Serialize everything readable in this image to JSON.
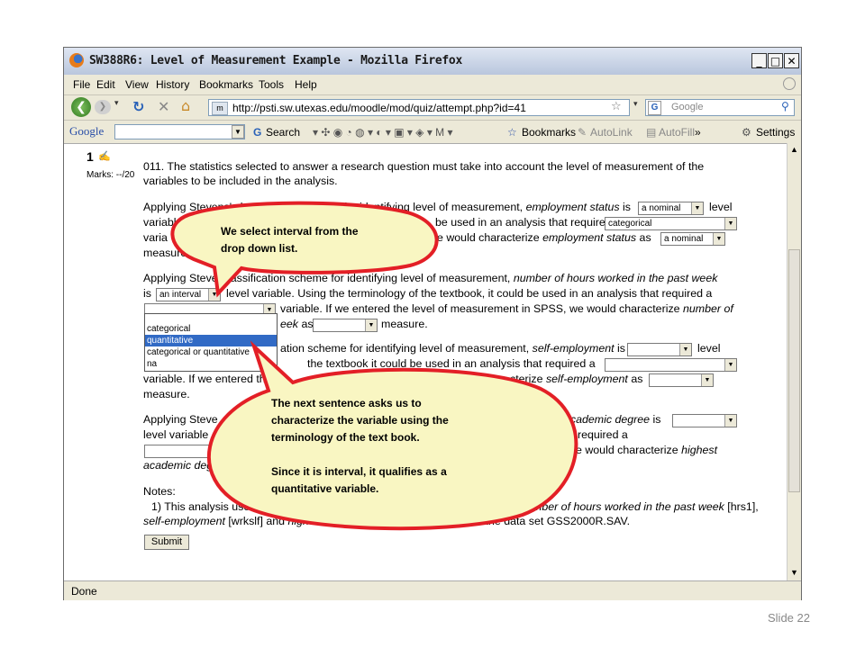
{
  "window": {
    "title": "SW388R6: Level of Measurement Example - Mozilla Firefox",
    "buttons": [
      "_",
      "□",
      "✕"
    ]
  },
  "menu": {
    "items": [
      "File",
      "Edit",
      "View",
      "History",
      "Bookmarks",
      "Tools",
      "Help"
    ]
  },
  "nav": {
    "url": "http://psti.sw.utexas.edu/moodle/mod/quiz/attempt.php?id=41",
    "search_placeholder": "Google"
  },
  "google_toolbar": {
    "brand": "Google",
    "search_label": "Search",
    "bookmarks_label": "Bookmarks",
    "autolink_label": "AutoLink",
    "autofill_label": "AutoFill",
    "more_label": "»",
    "settings_label": "Settings"
  },
  "quiz": {
    "question_number": "1",
    "marks": "Marks: --/20",
    "intro_line1": "011. The statistics selected to answer a research question must take into account the level of measurement of the",
    "intro_line2": "variables to be included in the analysis.",
    "q1_line1a": "Applying Stevens' classification scheme for identifying level of measurement,",
    "q1_var": "employment status",
    "q1_line1b": "is",
    "q1_sel1": "a nominal",
    "q1_line1c": "level",
    "q1_line2a": "variable. U",
    "q1_line2b": "be used in an analysis that required a",
    "q1_sel2": "categorical",
    "q1_line3a": "varia",
    "q1_line3b": "e would characterize",
    "q1_line3c": "employment status",
    "q1_line3d": "as",
    "q1_sel3": "a nominal",
    "q1_line4a": "measure",
    "q2_line1a": "Applying Steve",
    "q2_line1b": "lassification scheme for identifying level of measurement,",
    "q2_var": "number of hours worked in the past week",
    "q2_line2a": "is",
    "q2_sel1": "an interval",
    "q2_line2b": "level variable. Using the terminology of the textbook, it could be used in an analysis that required a",
    "q2_line3a": "variable. If we entered the level of measurement in SPSS, we would characterize",
    "q2_line3b": "number of",
    "q2_line4a": "eek",
    "q2_line4b": "as",
    "q2_line4c": "measure.",
    "dropdown_options": [
      "categorical",
      "quantitative",
      "categorical or quantitative",
      "na"
    ],
    "q3_line1a": "ation scheme for identifying level of measurement,",
    "q3_var": "self-employment",
    "q3_line1b": "is",
    "q3_line1c": "level",
    "q3_line2a": "the textbook it could be used in an analysis that required a",
    "q3_line3a": "variable. If we entered the",
    "q3_line3b": "cterize",
    "q3_line3c": "self-employment",
    "q3_line3d": "as",
    "q3_line4a": "measure.",
    "q4_line1a": "Applying Steve",
    "q4_line1b": "academic degree",
    "q4_line1c": "is",
    "q4_line2a": "level variable",
    "q4_line2b": "required a",
    "q4_line3b": "e would characterize",
    "q4_line3c": "highest",
    "q4_line4a": "academic deg",
    "notes_label": "Notes:",
    "notes_line1a": "1) This analysis used the va",
    "notes_line1b": "mber of hours worked in the past week",
    "notes_line1c": "[hrs1],",
    "notes_line2a": "self-employment",
    "notes_line2b": "[wrkslf] and",
    "notes_line2c": "highest academic degree",
    "notes_line2d": "[degree] from the data set GSS2000R.SAV.",
    "submit": "Submit"
  },
  "callouts": {
    "top_line1": "We select interval from the",
    "top_line2": "drop down list.",
    "bottom_line1": "The next sentence asks us to",
    "bottom_line2": "characterize the variable using the",
    "bottom_line3": "terminology of the text book.",
    "bottom_line4": "Since it is interval, it qualifies as a",
    "bottom_line5": "quantitative variable."
  },
  "status": {
    "text": "Done"
  },
  "slide": {
    "number": "Slide 22"
  },
  "colors": {
    "callout_fill": "#f9f6c2",
    "callout_border": "#e31f26",
    "selection": "#316ac5"
  }
}
